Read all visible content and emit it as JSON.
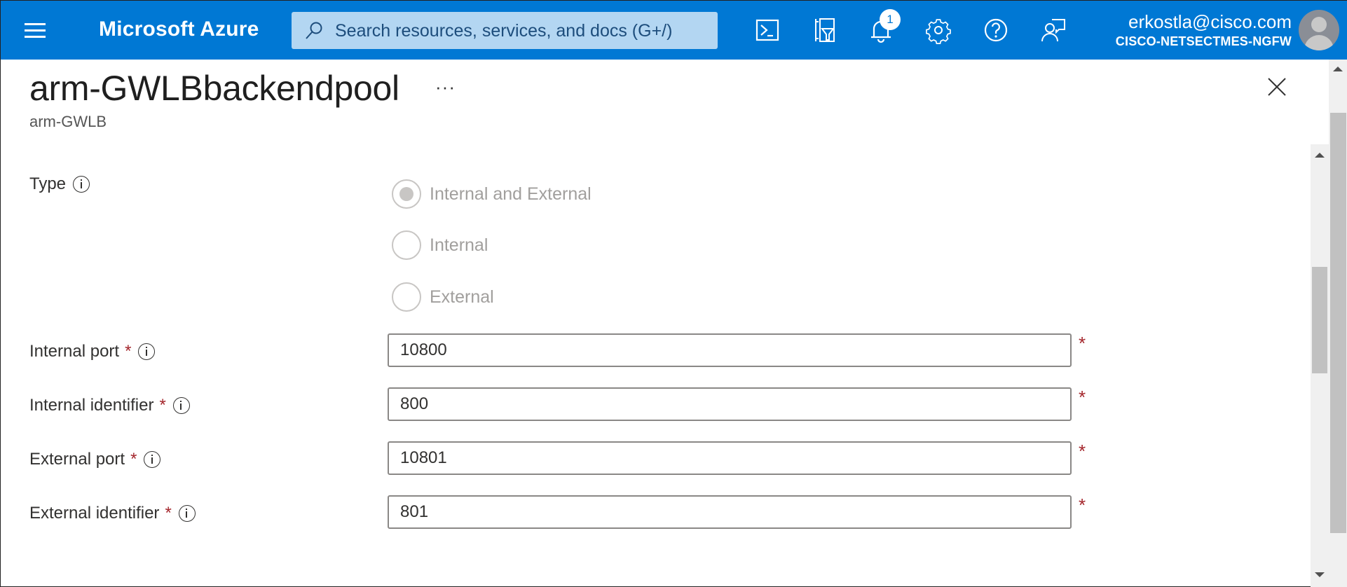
{
  "topbar": {
    "brand": "Microsoft Azure",
    "search_placeholder": "Search resources, services, and docs (G+/)",
    "notification_count": "1",
    "user_email": "erkostla@cisco.com",
    "user_tenant": "CISCO-NETSECTMES-NGFW",
    "icons": [
      "menu-icon",
      "cloud-shell-icon",
      "directory-filter-icon",
      "notifications-icon",
      "settings-icon",
      "help-icon",
      "feedback-icon"
    ],
    "accent_color": "#0078d4"
  },
  "page": {
    "title": "arm-GWLBbackendpool",
    "more_label": "···",
    "subtitle": "arm-GWLB"
  },
  "form": {
    "type": {
      "label": "Type",
      "options": [
        {
          "label": "Internal and External",
          "checked": true
        },
        {
          "label": "Internal",
          "checked": false
        },
        {
          "label": "External",
          "checked": false
        }
      ],
      "disabled": true
    },
    "fields": [
      {
        "label": "Internal port",
        "required_mark": "*",
        "value": "10800"
      },
      {
        "label": "Internal identifier",
        "required_mark": "*",
        "value": "800"
      },
      {
        "label": "External port",
        "required_mark": "*",
        "value": "10801"
      },
      {
        "label": "External identifier",
        "required_mark": "*",
        "value": "801"
      }
    ]
  }
}
